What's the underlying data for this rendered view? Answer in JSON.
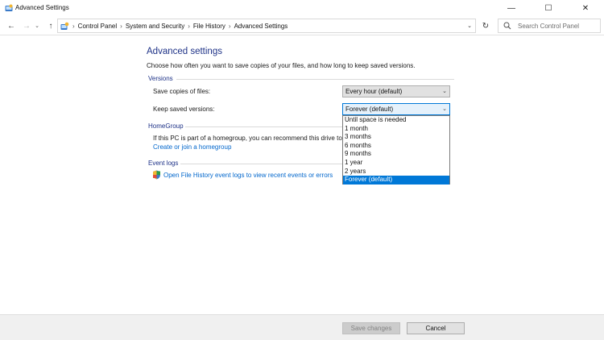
{
  "window": {
    "title": "Advanced Settings",
    "minimize_glyph": "—",
    "maximize_glyph": "☐",
    "close_glyph": "✕"
  },
  "nav": {
    "back_glyph": "←",
    "forward_glyph": "→",
    "recent_glyph": "⌄",
    "up_glyph": "↑",
    "refresh_glyph": "↻",
    "dropdown_glyph": "⌄"
  },
  "breadcrumb": {
    "lead_sep": "›",
    "items": [
      "Control Panel",
      "System and Security",
      "File History",
      "Advanced Settings"
    ],
    "sep": "›"
  },
  "search": {
    "placeholder": "Search Control Panel"
  },
  "main": {
    "heading": "Advanced settings",
    "description": "Choose how often you want to save copies of your files, and how long to keep saved versions.",
    "versions": {
      "label": "Versions",
      "save_copies_label": "Save copies of files:",
      "save_copies_value": "Every hour (default)",
      "keep_versions_label": "Keep saved versions:",
      "keep_versions_value": "Forever (default)",
      "chevron": "⌄"
    },
    "homegroup": {
      "label": "HomeGroup",
      "text": "If this PC is part of a homegroup, you can recommend this drive to",
      "link": "Create or join a homegroup"
    },
    "event_logs": {
      "label": "Event logs",
      "link": "Open File History event logs to view recent events or errors"
    }
  },
  "dropdown": {
    "options": [
      "Until space is needed",
      "1 month",
      "3 months",
      "6 months",
      "9 months",
      "1 year",
      "2 years",
      "Forever (default)"
    ],
    "selected_index": 7
  },
  "footer": {
    "save_label": "Save changes",
    "cancel_label": "Cancel"
  },
  "colors": {
    "accent": "#0078d7",
    "heading": "#1e3287",
    "link": "#0066cc"
  }
}
